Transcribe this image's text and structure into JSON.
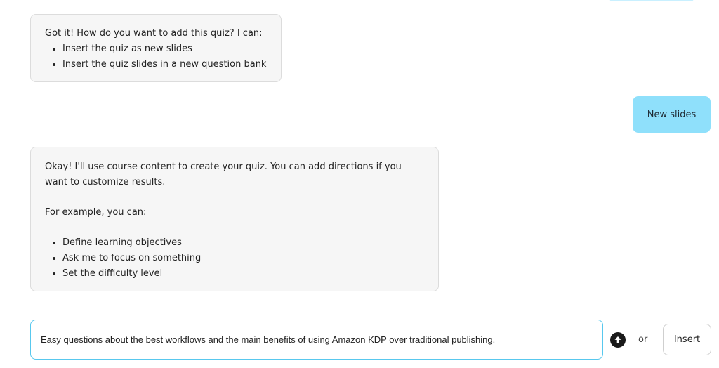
{
  "conversation": {
    "bot_message_1": {
      "intro": "Got it! How do you want to add this quiz? I can:",
      "options": [
        "Insert the quiz as new slides",
        "Insert the quiz slides in a new question bank"
      ]
    },
    "user_message_1": {
      "text": "New slides"
    },
    "bot_message_2": {
      "paragraph": "Okay! I'll use course content to create your quiz. You can add directions if you want to customize results.",
      "example_intro": "For example, you can:",
      "examples": [
        "Define learning objectives",
        "Ask me to focus on something",
        "Set the difficulty level"
      ]
    }
  },
  "composer": {
    "input_value": "Easy questions about the best workflows and the main benefits of using Amazon KDP over traditional publishing.",
    "send_icon": "arrow-up-circle-icon",
    "or_label": "or",
    "insert_label": "Insert"
  },
  "colors": {
    "user_bubble": "#8fe0fb",
    "bot_bubble": "#f6f6f6",
    "input_border": "#58c8ee"
  }
}
